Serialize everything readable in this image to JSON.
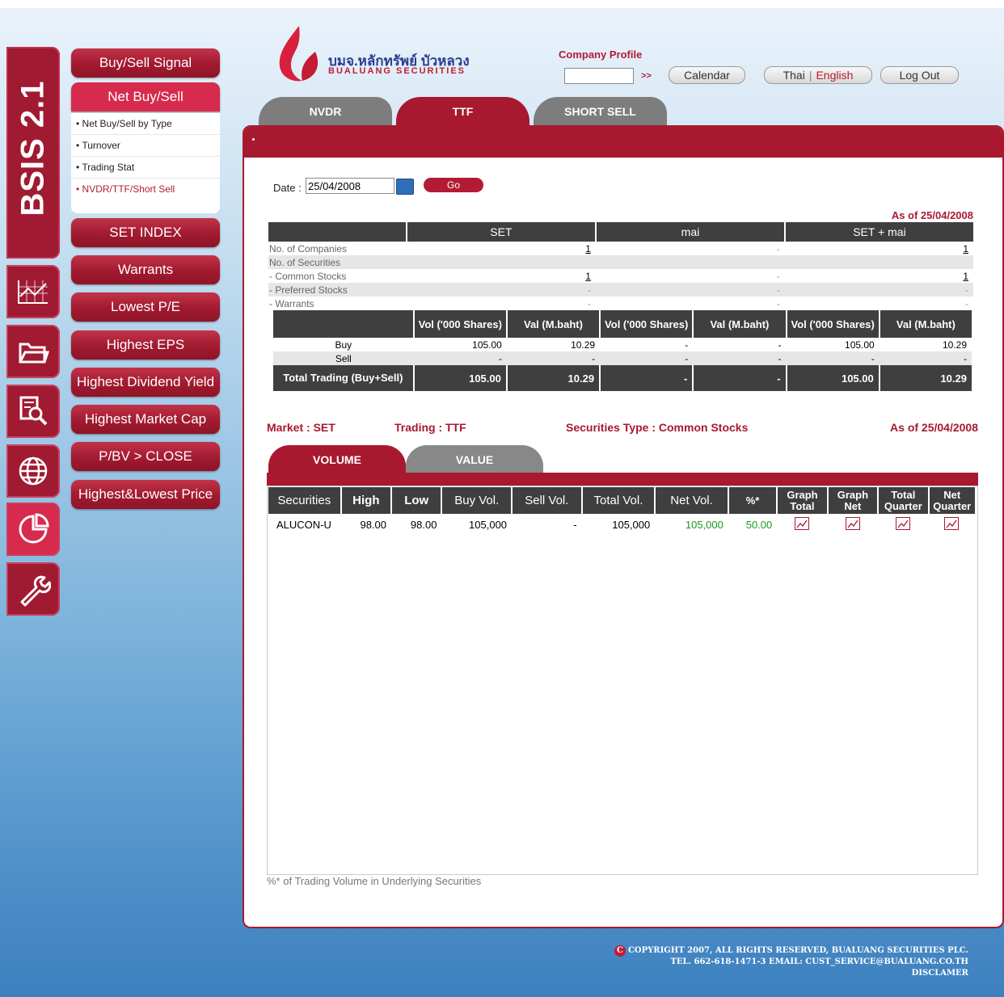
{
  "sidebar": {
    "brand": "BSIS 2.1",
    "icons": [
      "chart-line-icon",
      "folder-icon",
      "document-search-icon",
      "globe-icon",
      "pie-chart-icon",
      "wrench-icon"
    ]
  },
  "menu": {
    "items": [
      "Buy/Sell Signal",
      "Net Buy/Sell",
      "SET INDEX",
      "Warrants",
      "Lowest P/E",
      "Highest EPS",
      "Highest Dividend Yield",
      "Highest Market Cap",
      "P/BV > CLOSE",
      "Highest&Lowest Price"
    ],
    "sub_items": [
      "• Net Buy/Sell by Type",
      "• Turnover",
      "• Trading Stat",
      "• NVDR/TTF/Short Sell"
    ]
  },
  "header": {
    "logo_thai": "บมจ.หลักทรัพย์ บัวหลวง",
    "logo_en": "BUALUANG SECURITIES",
    "company_profile": "Company Profile",
    "go_arrows": ">>",
    "calendar": "Calendar",
    "thai": "Thai",
    "sep": "|",
    "english": "English",
    "logout": "Log Out"
  },
  "tabs": [
    "NVDR",
    "TTF",
    "SHORT SELL"
  ],
  "form": {
    "date_label": "Date :",
    "date_value": "25/04/2008",
    "go": "Go"
  },
  "summary": {
    "as_of": "As of 25/04/2008",
    "cols": [
      "SET",
      "mai",
      "SET + mai"
    ],
    "rows": [
      {
        "label": "No. of Companies",
        "set": "1",
        "mai": "-",
        "both": "1"
      },
      {
        "label": "No. of Securities",
        "set": "",
        "mai": "",
        "both": ""
      },
      {
        "label": "- Common Stocks",
        "set": "1",
        "mai": "-",
        "both": "1"
      },
      {
        "label": "- Preferred Stocks",
        "set": "-",
        "mai": "-",
        "both": "-"
      },
      {
        "label": "- Warrants",
        "set": "-",
        "mai": "-",
        "both": "-"
      }
    ],
    "sub_headers": [
      "Vol ('000 Shares)",
      "Val (M.baht)",
      "Vol ('000 Shares)",
      "Val (M.baht)",
      "Vol ('000 Shares)",
      "Val (M.baht)"
    ],
    "trade_rows": [
      {
        "label": "Buy",
        "v": [
          "105.00",
          "10.29",
          "-",
          "-",
          "105.00",
          "10.29"
        ]
      },
      {
        "label": "Sell",
        "v": [
          "-",
          "-",
          "-",
          "-",
          "-",
          "-"
        ]
      }
    ],
    "total": {
      "label": "Total Trading (Buy+Sell)",
      "v": [
        "105.00",
        "10.29",
        "-",
        "-",
        "105.00",
        "10.29"
      ]
    }
  },
  "info": {
    "market": "Market : SET",
    "trading": "Trading : TTF",
    "sec_type": "Securities Type : Common Stocks",
    "as_of": "As of 25/04/2008"
  },
  "subtabs": [
    "VOLUME",
    "VALUE"
  ],
  "detail": {
    "headers": [
      "Securities",
      "High",
      "Low",
      "Buy Vol.",
      "Sell Vol.",
      "Total Vol.",
      "Net Vol.",
      "%*",
      "Graph Total",
      "Graph Net",
      "Total Quarter",
      "Net Quarter"
    ],
    "rows": [
      {
        "sec": "ALUCON-U",
        "high": "98.00",
        "low": "98.00",
        "buy": "105,000",
        "sell": "-",
        "total": "105,000",
        "net": "105,000",
        "pct": "50.00"
      }
    ],
    "footnote": "%* of Trading Volume in Underlying Securities"
  },
  "footer": {
    "line1": "COPYRIGHT 2007, ALL RIGHTS RESERVED, BUALUANG SECURITIES PLC.",
    "line2": "TEL. 662-618-1471-3 EMAIL: CUST_SERVICE@BUALUANG.CO.TH",
    "line3": "DISCLAMER"
  },
  "colors": {
    "brand": "#a8192f",
    "accent": "#d62b4c",
    "green": "#1a9a1a"
  }
}
